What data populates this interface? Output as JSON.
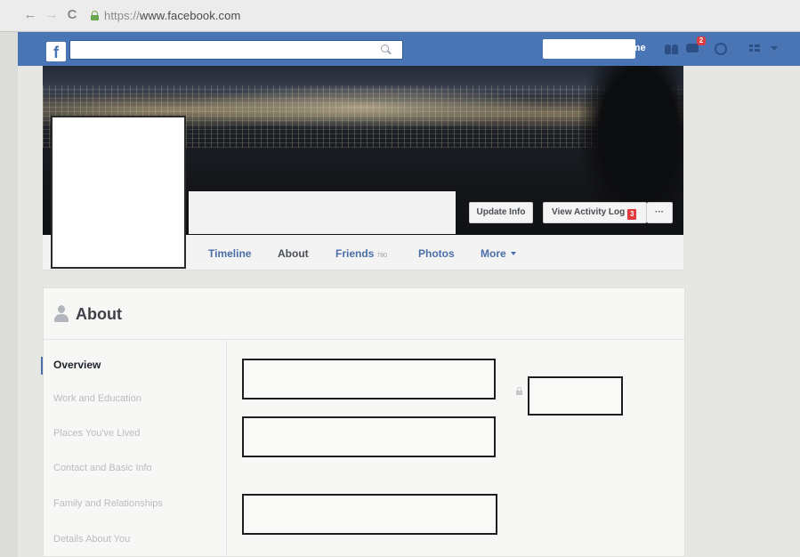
{
  "browser": {
    "back_icon": "←",
    "forward_icon": "→",
    "reload_icon": "C",
    "url_scheme": "https://",
    "url_host": "www.facebook.com"
  },
  "topbar": {
    "logo": "f",
    "home_label": "Home",
    "messages_badge": "2"
  },
  "cover": {
    "update_info_label": "Update Info",
    "activity_log_label": "View Activity Log",
    "activity_log_badge": "3",
    "more_label": "···"
  },
  "tabs": {
    "timeline": "Timeline",
    "about": "About",
    "friends": "Friends",
    "friends_count": "780",
    "photos": "Photos",
    "more": "More"
  },
  "about": {
    "title": "About",
    "sidebar": [
      {
        "label": "Overview",
        "active": true
      },
      {
        "label": "Work and Education",
        "active": false
      },
      {
        "label": "Places You've Lived",
        "active": false
      },
      {
        "label": "Contact and Basic Info",
        "active": false
      },
      {
        "label": "Family and Relationships",
        "active": false
      },
      {
        "label": "Details About You",
        "active": false
      }
    ]
  },
  "colors": {
    "facebook_blue": "#4a75b5",
    "link_blue": "#4b6fa8",
    "badge_red": "#e0393e"
  }
}
